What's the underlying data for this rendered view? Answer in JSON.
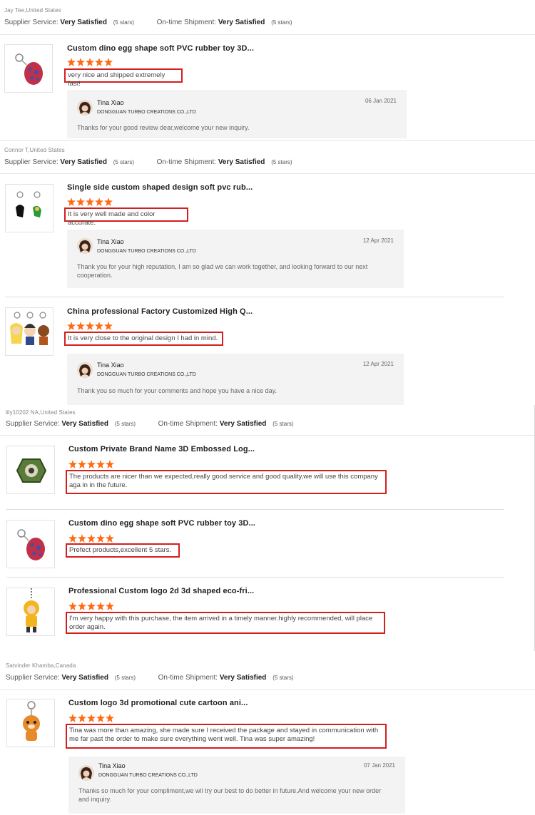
{
  "labels": {
    "supplier_service": "Supplier Service:",
    "ontime_shipment": "On-time Shipment:"
  },
  "accent": "#ff6a13",
  "highlight_border": "#d41f1f",
  "reviews": [
    {
      "reviewer": "Jay Tee,United States",
      "supplier_service": "Very Satisfied",
      "supplier_stars": "(5 stars)",
      "shipment": "Very Satisfied",
      "shipment_stars": "(5 stars)",
      "products": [
        {
          "title": "Custom dino egg shape soft PVC rubber toy 3D...",
          "rating": 5,
          "comment": "very nice and shipped extremely fast!",
          "reply": {
            "name": "Tina Xiao",
            "company": "DONGGUAN TURBO CREATIONS CO.,LTD",
            "date": "06 Jan 2021",
            "text": "Thanks for your good review dear,welcome your new inquiry."
          }
        }
      ]
    },
    {
      "reviewer": "Connor T,United States",
      "supplier_service": "Very Satisfied",
      "supplier_stars": "(5 stars)",
      "shipment": "Very Satisfied",
      "shipment_stars": "(5 stars)",
      "products": [
        {
          "title": "Single side custom shaped design soft pvc rub...",
          "rating": 5,
          "comment": "It is very well made and color accurate.",
          "reply": {
            "name": "Tina Xiao",
            "company": "DONGGUAN TURBO CREATIONS CO.,LTD",
            "date": "12 Apr 2021",
            "text": "Thank you for your high reputation, I am so glad we can work together, and looking forward to our next cooperation."
          }
        },
        {
          "title": "China professional Factory Customized High Q...",
          "rating": 5,
          "comment": "It is very close to the original design I had in mind.",
          "reply": {
            "name": "Tina Xiao",
            "company": "DONGGUAN TURBO CREATIONS CO.,LTD",
            "date": "12 Apr 2021",
            "text": "Thank you so much for your comments and hope you have a nice day."
          }
        }
      ]
    },
    {
      "reviewer": "lily10202 NA,United States",
      "supplier_service": "Very Satisfied",
      "supplier_stars": "(5 stars)",
      "shipment": "Very Satisfied",
      "shipment_stars": "(5 stars)",
      "products": [
        {
          "title": "Custom Private Brand Name 3D Embossed Log...",
          "rating": 5,
          "comment": "The products are nicer than we expected,really good service and good quality,we will use this company aga in in the future."
        },
        {
          "title": "Custom dino egg shape soft PVC rubber toy 3D...",
          "rating": 5,
          "comment": "Prefect products,excellent 5 stars."
        },
        {
          "title": "Professional Custom logo 2d 3d shaped eco-fri...",
          "rating": 5,
          "comment": "I'm very happy with this purchase, the item arrived in a timely manner.highly recommended, will place order again."
        }
      ]
    },
    {
      "reviewer": "Satvinder Khamba,Canada",
      "supplier_service": "Very Satisfied",
      "supplier_stars": "(5 stars)",
      "shipment": "Very Satisfied",
      "shipment_stars": "(5 stars)",
      "products": [
        {
          "title": "Custom logo 3d promotional cute cartoon ani...",
          "rating": 5,
          "comment": "Tina was more than amazing, she made sure I received the package and stayed in communication with me far past the order to make sure everything went well. Tina was super amazing!",
          "reply": {
            "name": "Tina Xiao",
            "company": "DONGGUAN TURBO CREATIONS CO.,LTD",
            "date": "07 Jan 2021",
            "text": "Thanks so much for your  compliment,we wil try our best to do better in future.And welcome your new order and inquiry."
          }
        }
      ]
    }
  ]
}
